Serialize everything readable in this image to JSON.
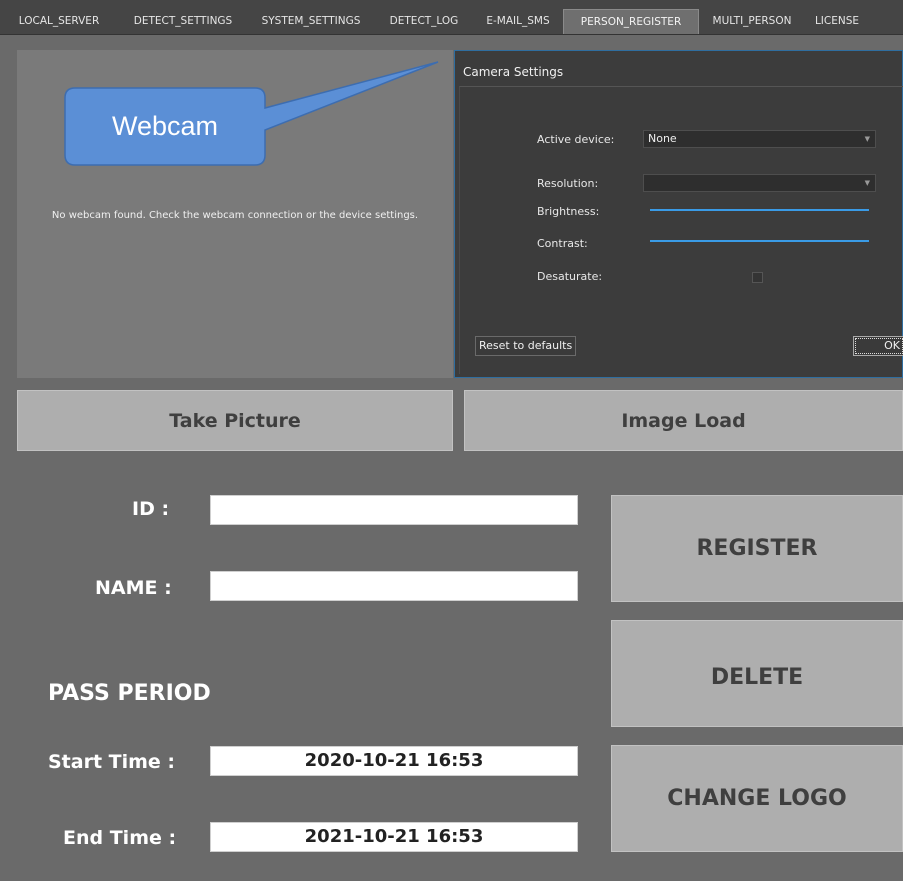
{
  "tabs": [
    {
      "label": "LOCAL_SERVER",
      "active": false
    },
    {
      "label": "DETECT_SETTINGS",
      "active": false
    },
    {
      "label": "SYSTEM_SETTINGS",
      "active": false
    },
    {
      "label": "DETECT_LOG",
      "active": false
    },
    {
      "label": "E-MAIL_SMS",
      "active": false
    },
    {
      "label": "PERSON_REGISTER",
      "active": true
    },
    {
      "label": "MULTI_PERSON",
      "active": false
    },
    {
      "label": "LICENSE",
      "active": false
    }
  ],
  "webcam": {
    "message": "No webcam found. Check the webcam connection or the device settings.",
    "callout_label": "Webcam"
  },
  "camera_settings": {
    "title": "Camera Settings",
    "active_device_label": "Active device:",
    "active_device_value": "None",
    "resolution_label": "Resolution:",
    "resolution_value": "",
    "brightness_label": "Brightness:",
    "contrast_label": "Contrast:",
    "desaturate_label": "Desaturate:",
    "desaturate_checked": false,
    "reset_label": "Reset to defaults",
    "ok_label": "OK"
  },
  "actions": {
    "take_picture": "Take Picture",
    "image_load": "Image Load",
    "register": "REGISTER",
    "delete": "DELETE",
    "change_logo": "CHANGE LOGO"
  },
  "form": {
    "id_label": "ID :",
    "id_value": "",
    "name_label": "NAME :",
    "name_value": "",
    "pass_period_title": "PASS PERIOD",
    "start_label": "Start Time :",
    "start_value": "2020-10-21 16:53",
    "end_label": "End Time :",
    "end_value": "2021-10-21 16:53"
  },
  "colors": {
    "background": "#6a6a6a",
    "button": "#aeaeae",
    "slider": "#3a9be6",
    "callout": "#5b8fd6"
  }
}
